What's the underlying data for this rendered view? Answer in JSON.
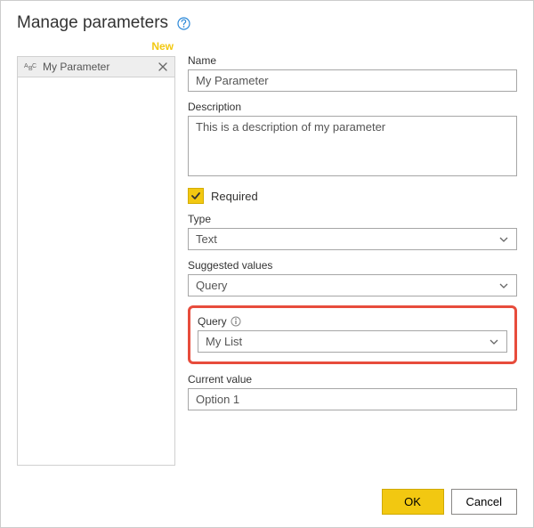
{
  "header": {
    "title": "Manage parameters"
  },
  "sidebar": {
    "new_label": "New",
    "items": [
      {
        "name": "My Parameter"
      }
    ]
  },
  "form": {
    "name_label": "Name",
    "name_value": "My Parameter",
    "description_label": "Description",
    "description_value": "This is a description of my parameter",
    "required_label": "Required",
    "required_checked": true,
    "type_label": "Type",
    "type_value": "Text",
    "suggested_label": "Suggested values",
    "suggested_value": "Query",
    "query_label": "Query",
    "query_value": "My List",
    "current_label": "Current value",
    "current_value": "Option 1"
  },
  "footer": {
    "ok_label": "OK",
    "cancel_label": "Cancel"
  }
}
